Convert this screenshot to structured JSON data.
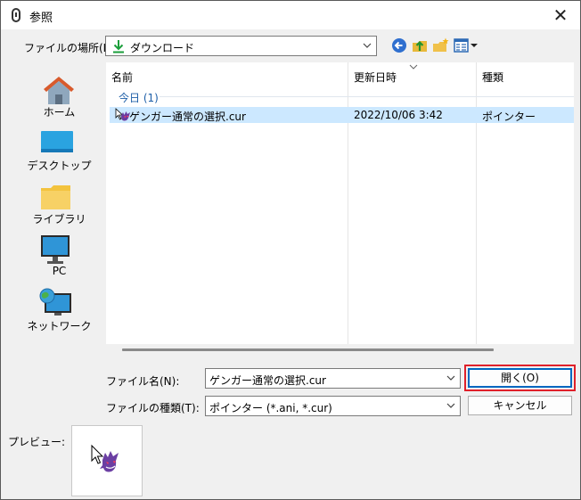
{
  "window": {
    "title": "参照",
    "close_glyph": "✕"
  },
  "toolbar": {
    "look_in_label": "ファイルの場所(I):",
    "look_in_value": "ダウンロード",
    "buttons": [
      "back-icon",
      "up-folder-icon",
      "new-folder-icon",
      "view-menu-icon"
    ]
  },
  "places": [
    {
      "label": "ホーム",
      "icon": "home-icon"
    },
    {
      "label": "デスクトップ",
      "icon": "desktop-icon"
    },
    {
      "label": "ライブラリ",
      "icon": "library-folder-icon"
    },
    {
      "label": "PC",
      "icon": "pc-monitor-icon"
    },
    {
      "label": "ネットワーク",
      "icon": "network-icon"
    }
  ],
  "file_list": {
    "columns": [
      "名前",
      "更新日時",
      "種類"
    ],
    "group_label": "今日 (1)",
    "rows": [
      {
        "name": "ゲンガー通常の選択.cur",
        "modified": "2022/10/06 3:42",
        "type": "ポインター",
        "selected": true
      }
    ]
  },
  "form": {
    "filename_label": "ファイル名(N):",
    "filename_value": "ゲンガー通常の選択.cur",
    "filetype_label": "ファイルの種類(T):",
    "filetype_value": "ポインター (*.ani, *.cur)",
    "open_button": "開く(O)",
    "cancel_button": "キャンセル"
  },
  "preview": {
    "label": "プレビュー:"
  },
  "colors": {
    "selection": "#cce8ff",
    "group_text": "#1e5fa8",
    "focus_highlight": "#e0202a",
    "default_button_border": "#0067c0"
  }
}
